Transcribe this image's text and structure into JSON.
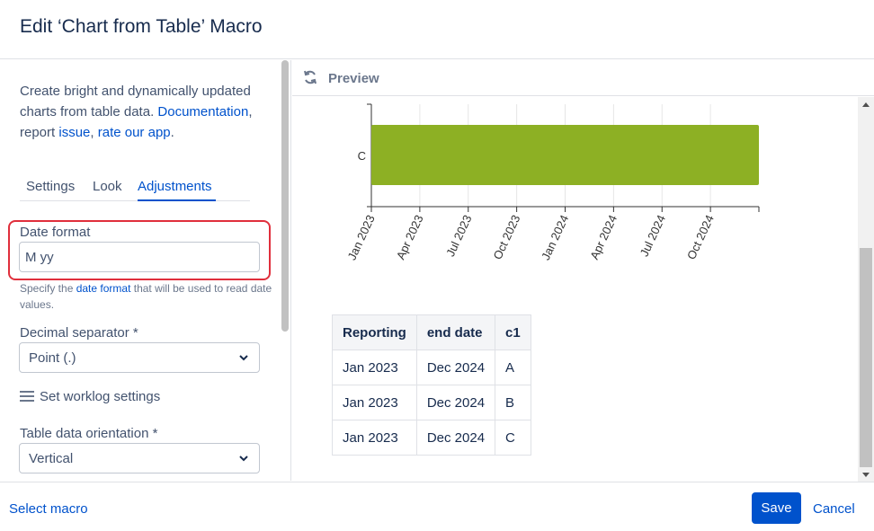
{
  "dialog": {
    "title": "Edit ‘Chart from Table’ Macro"
  },
  "intro": {
    "text_1": "Create bright and dynamically updated charts from table data. ",
    "documentation_link": "Documentation",
    "text_2": ", report ",
    "issue_link": "issue",
    "text_3": ", ",
    "rate_link": "rate our app",
    "text_4": "."
  },
  "tabs": [
    {
      "label": "Settings",
      "active": false
    },
    {
      "label": "Look",
      "active": false
    },
    {
      "label": "Adjustments",
      "active": true
    }
  ],
  "date_format": {
    "label": "Date format",
    "value": "M yy",
    "help_prefix": "Specify the ",
    "help_link": "date format",
    "help_suffix": " that will be used to read date values."
  },
  "decimal_separator": {
    "label": "Decimal separator *",
    "value": "Point (.)"
  },
  "worklog": {
    "label": "Set worklog settings"
  },
  "orientation": {
    "label": "Table data orientation *",
    "value": "Vertical"
  },
  "preview": {
    "label": "Preview"
  },
  "chart_data": {
    "type": "bar",
    "orientation": "horizontal-gantt",
    "categories": [
      "C"
    ],
    "series": [
      {
        "values": [
          {
            "category": "C",
            "start": "Jan 2023",
            "end": "Dec 2024"
          }
        ],
        "color": "#8db024"
      }
    ],
    "x_ticks": [
      "Jan 2023",
      "Apr 2023",
      "Jul 2023",
      "Oct 2023",
      "Jan 2024",
      "Apr 2024",
      "Jul 2024",
      "Oct 2024"
    ],
    "xlim": [
      "Jan 2023",
      "Dec 2024"
    ],
    "grid": true
  },
  "table": {
    "headers": [
      "Reporting",
      "end date",
      "c1"
    ],
    "rows": [
      [
        "Jan 2023",
        "Dec 2024",
        "A"
      ],
      [
        "Jan 2023",
        "Dec 2024",
        "B"
      ],
      [
        "Jan 2023",
        "Dec 2024",
        "C"
      ]
    ]
  },
  "footer": {
    "select_macro": "Select macro",
    "save": "Save",
    "cancel": "Cancel"
  },
  "colors": {
    "accent": "#0052cc",
    "highlight": "#e02f3c",
    "bar": "#8db024"
  }
}
